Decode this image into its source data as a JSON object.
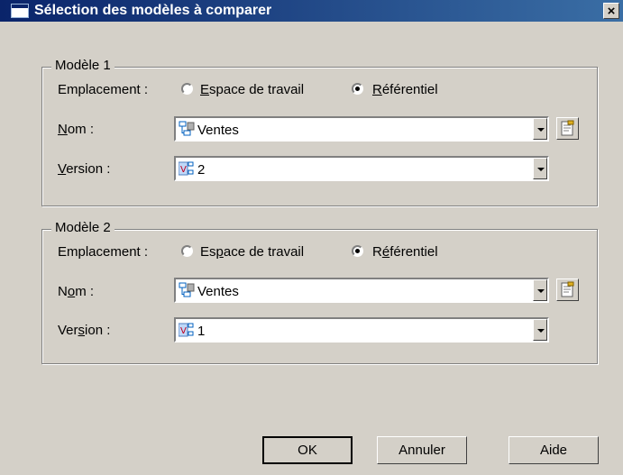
{
  "window": {
    "title": "Sélection des modèles à comparer",
    "close_label": "×"
  },
  "model1": {
    "group_title": "Modèle 1",
    "location_label": "Emplacement :",
    "workspace_option": "Espace de travail",
    "repository_option": "Référentiel",
    "selected_location": "Référentiel",
    "name_label": "Nom :",
    "name_value": "Ventes",
    "version_label": "Version :",
    "version_value": "2"
  },
  "model2": {
    "group_title": "Modèle 2",
    "location_label": "Emplacement :",
    "workspace_option": "Espace de travail",
    "repository_option": "Référentiel",
    "selected_location": "Référentiel",
    "name_label": "Nom :",
    "name_value": "Ventes",
    "version_label": "Version :",
    "version_value": "1"
  },
  "buttons": {
    "ok": "OK",
    "cancel": "Annuler",
    "help": "Aide"
  },
  "colors": {
    "titlebar_start": "#0a246a",
    "titlebar_end": "#3a6ea5",
    "dialog_bg": "#d4d0c8"
  },
  "icons": [
    "dialog-icon",
    "model-icon",
    "version-icon",
    "properties-icon",
    "dropdown-arrow-icon"
  ]
}
